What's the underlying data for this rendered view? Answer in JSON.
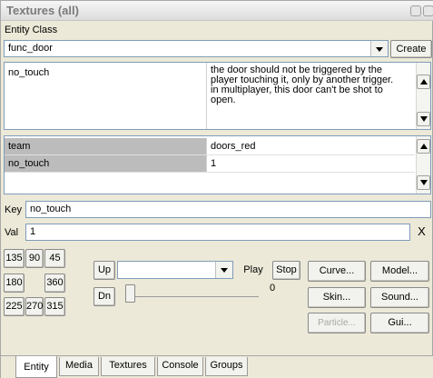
{
  "window": {
    "title": "Textures (all)"
  },
  "entity_class": {
    "label": "Entity Class",
    "value": "func_door",
    "create_label": "Create"
  },
  "spawnflags": {
    "name": "no_touch",
    "description": "the door should not be triggered by the player touching it, only by another trigger. in multiplayer, this door can't be shot to open."
  },
  "keyvalues": [
    {
      "key": "team",
      "value": "doors_red"
    },
    {
      "key": "no_touch",
      "value": "1"
    }
  ],
  "key_field": {
    "label": "Key",
    "value": "no_touch"
  },
  "val_field": {
    "label": "Val",
    "value": "1",
    "clear_label": "X"
  },
  "angles": [
    "135",
    "90",
    "45",
    "180",
    "360",
    "225",
    "270",
    "315"
  ],
  "updown": {
    "up": "Up",
    "down": "Dn"
  },
  "sound_player": {
    "selected": "",
    "play": "Play",
    "stop": "Stop",
    "slider_value": "0"
  },
  "actions": {
    "curve": "Curve...",
    "model": "Model...",
    "skin": "Skin...",
    "sound": "Sound...",
    "particle": "Particle...",
    "gui": "Gui..."
  },
  "tabs": [
    "Entity",
    "Media",
    "Textures",
    "Console",
    "Groups"
  ],
  "icons": {
    "dropdown": "chevron-down-icon",
    "scroll_up": "scroll-up-arrow-icon",
    "scroll_down": "scroll-down-arrow-icon"
  }
}
